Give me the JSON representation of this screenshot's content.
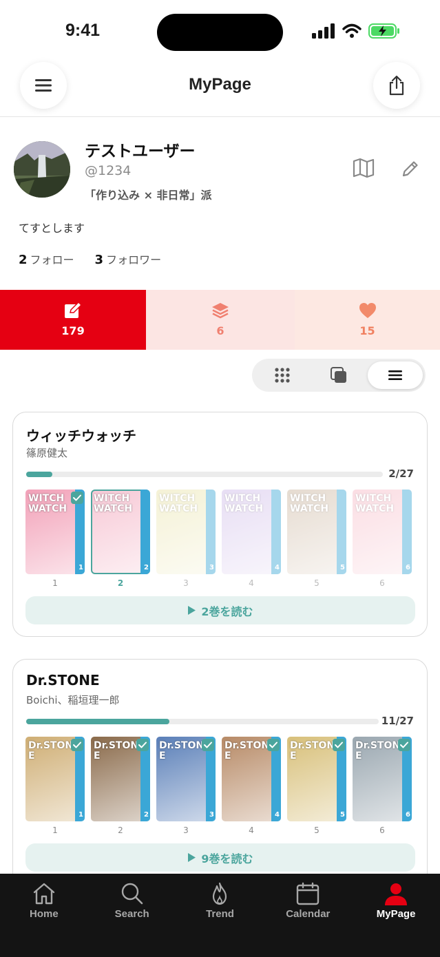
{
  "status": {
    "time": "9:41"
  },
  "header": {
    "title": "MyPage"
  },
  "profile": {
    "name": "テストユーザー",
    "handle": "@1234",
    "tag": "「作り込み × 非日常」派",
    "bio": "てすとします",
    "following_count": "2",
    "following_label": "フォロー",
    "followers_count": "3",
    "followers_label": "フォロワー"
  },
  "stats": [
    {
      "icon": "edit-icon",
      "count": "179",
      "active": true
    },
    {
      "icon": "layers-icon",
      "count": "6",
      "active": false
    },
    {
      "icon": "heart-icon",
      "count": "15",
      "active": false
    }
  ],
  "view_toggle": {
    "options": [
      "grid-icon",
      "stack-icon",
      "list-icon"
    ],
    "selected": "list-icon"
  },
  "series": [
    {
      "title": "ウィッチウォッチ",
      "author": "篠原健太",
      "progress_text": "2/27",
      "progress_fraction": 0.074,
      "cover_title": "WITCH WATCH",
      "volumes": [
        {
          "num": "1",
          "read": true,
          "current": false
        },
        {
          "num": "2",
          "read": false,
          "current": true
        },
        {
          "num": "3",
          "read": false,
          "current": false
        },
        {
          "num": "4",
          "read": false,
          "current": false
        },
        {
          "num": "5",
          "read": false,
          "current": false
        },
        {
          "num": "6",
          "read": false,
          "current": false
        }
      ],
      "read_button": "2巻を読む"
    },
    {
      "title": "Dr.STONE",
      "author": "Boichi、稲垣理一郎",
      "progress_text": "11/27",
      "progress_fraction": 0.407,
      "cover_title": "Dr.STONE",
      "volumes": [
        {
          "num": "1",
          "read": true,
          "current": false
        },
        {
          "num": "2",
          "read": true,
          "current": false
        },
        {
          "num": "3",
          "read": true,
          "current": false
        },
        {
          "num": "4",
          "read": true,
          "current": false
        },
        {
          "num": "5",
          "read": true,
          "current": false
        },
        {
          "num": "6",
          "read": true,
          "current": false
        }
      ],
      "read_button": "9巻を読む"
    }
  ],
  "nav": {
    "items": [
      {
        "label": "Home",
        "icon": "home-icon"
      },
      {
        "label": "Search",
        "icon": "search-icon"
      },
      {
        "label": "Trend",
        "icon": "flame-icon"
      },
      {
        "label": "Calendar",
        "icon": "calendar-icon"
      },
      {
        "label": "MyPage",
        "icon": "user-icon"
      }
    ],
    "active": "MyPage"
  },
  "colors": {
    "accent_red": "#e50012",
    "teal": "#4ba59d",
    "nav_bg": "#141414"
  }
}
